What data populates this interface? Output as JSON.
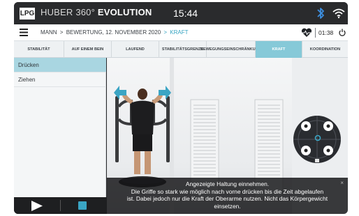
{
  "statusbar": {
    "logo_text": "LPG",
    "product_prefix": "HUBER 360°",
    "product_name": "EVOLUTION",
    "time": "15:44",
    "bluetooth_icon": "bluetooth-icon",
    "wifi_icon": "wifi-icon"
  },
  "breadcrumb": {
    "items": [
      "MANN",
      "BEWERTUNG, 12. NOVEMBER 2020",
      "KRAFT"
    ],
    "separator": ">",
    "session_timer": "01:38",
    "menu_icon": "hamburger-menu-icon",
    "heart_icon": "heart-rate-icon",
    "power_icon": "power-icon"
  },
  "tabs": [
    {
      "label": "STABILITÄT",
      "active": false
    },
    {
      "label": "AUF EINEM BEIN",
      "active": false
    },
    {
      "label": "LAUFEND",
      "active": false
    },
    {
      "label": "STABILITÄTSGRENZE",
      "active": false
    },
    {
      "label": "BEWEGUNGSEINSCHRÄNKUNG",
      "active": false
    },
    {
      "label": "KRAFT",
      "active": true
    },
    {
      "label": "KOORDINATION",
      "active": false
    }
  ],
  "exercises": [
    {
      "label": "Drücken",
      "active": true
    },
    {
      "label": "Ziehen",
      "active": false
    }
  ],
  "controls": {
    "play_icon": "play-icon",
    "stop_icon": "stop-icon"
  },
  "instruction": {
    "line1": "Angezeigte Haltung einnehmen.",
    "line2": "Die Griffe so stark wie möglich nach vorne drücken bis die Zeit abgelaufen",
    "line3": "ist. Dabei jedoch nur die Kraft der Oberarme nutzen. Nicht das Körpergewicht",
    "line4": "einsetzen.",
    "close": "×"
  },
  "colors": {
    "accent": "#36a4c2",
    "tab_active": "#86c9d8",
    "list_active": "#a9d6e1",
    "statusbar": "#2a2b2d"
  }
}
